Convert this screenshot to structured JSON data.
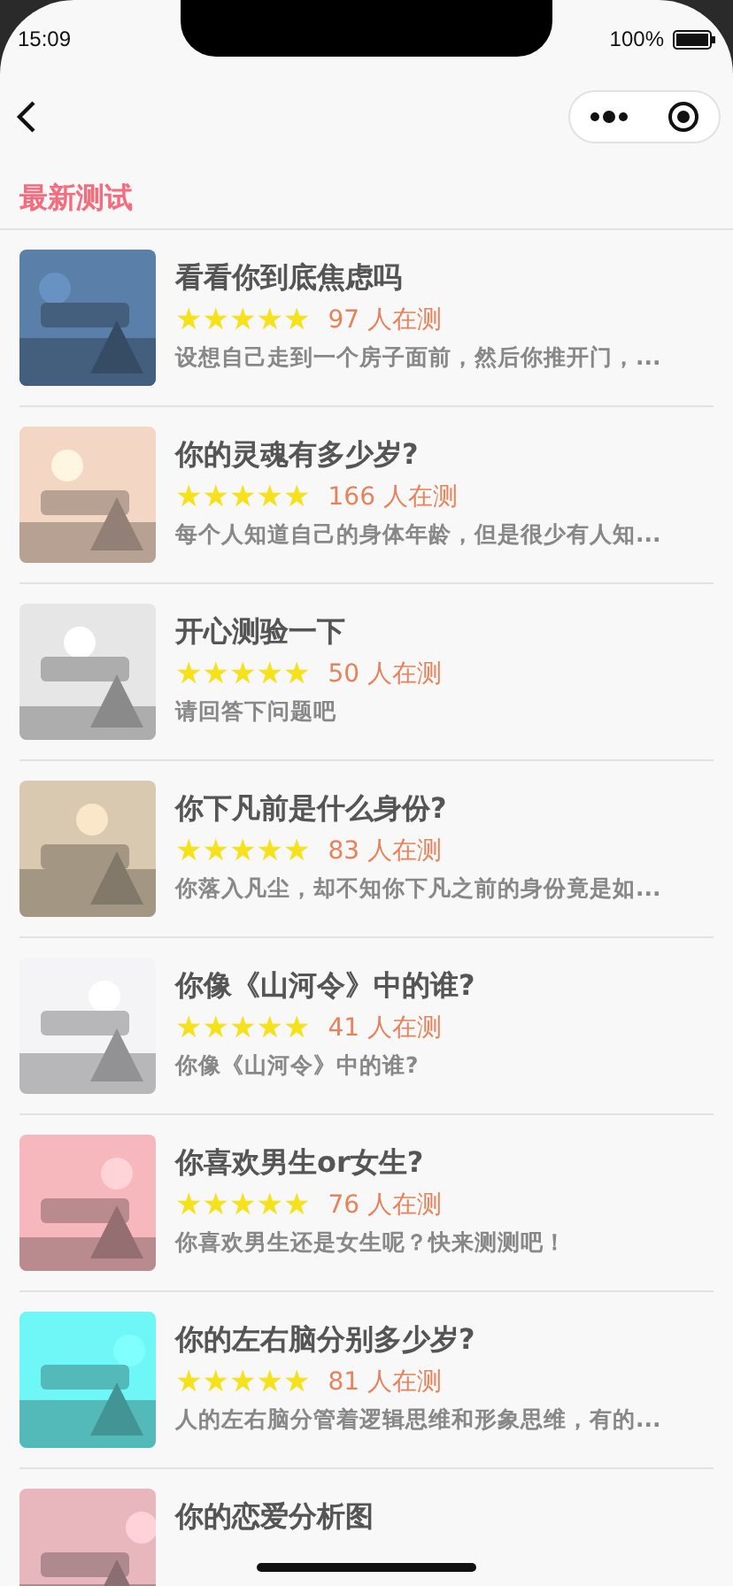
{
  "status_bar": {
    "time": "15:09",
    "battery": "100%"
  },
  "section": {
    "title": "最新测试"
  },
  "tests": [
    {
      "title": "看看你到底焦虑吗",
      "stars": 5,
      "count": "97 人在测",
      "description": "设想自己走到一个房子面前，然后你推开门，..."
    },
    {
      "title": "你的灵魂有多少岁?",
      "stars": 5,
      "count": "166 人在测",
      "description": "每个人知道自己的身体年龄，但是很少有人知..."
    },
    {
      "title": "开心测验一下",
      "stars": 5,
      "count": "50 人在测",
      "description": "请回答下问题吧"
    },
    {
      "title": "你下凡前是什么身份?",
      "stars": 5,
      "count": "83 人在测",
      "description": "你落入凡尘，却不知你下凡之前的身份竟是如..."
    },
    {
      "title": "你像《山河令》中的谁?",
      "stars": 5,
      "count": "41 人在测",
      "description": "你像《山河令》中的谁?"
    },
    {
      "title": "你喜欢男生or女生?",
      "stars": 5,
      "count": "76 人在测",
      "description": "你喜欢男生还是女生呢？快来测测吧！"
    },
    {
      "title": "你的左右脑分别多少岁?",
      "stars": 5,
      "count": "81 人在测",
      "description": "人的左右脑分管着逻辑思维和形象思维，有的..."
    },
    {
      "title": "你的恋爱分析图"
    }
  ]
}
